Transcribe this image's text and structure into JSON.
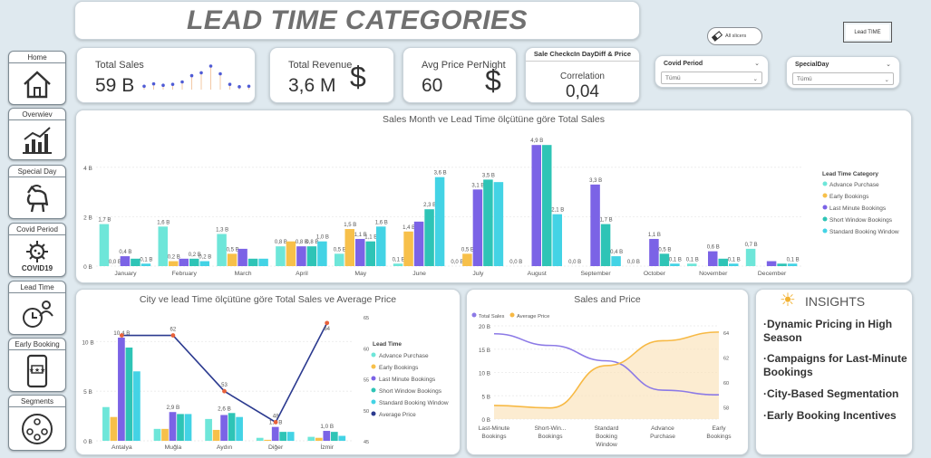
{
  "nav": [
    {
      "label": "Home",
      "icon": "house-icon"
    },
    {
      "label": "Overwiev",
      "icon": "bar-chart-icon"
    },
    {
      "label": "Special Day",
      "icon": "goat-icon"
    },
    {
      "label": "Covid Period",
      "icon": "covid-virus-icon",
      "caption": "COVID19"
    },
    {
      "label": "Lead Time",
      "icon": "lead-time-icon"
    },
    {
      "label": "Early Booking",
      "icon": "rating-phone-icon"
    },
    {
      "label": "Segments",
      "icon": "segments-people-icon"
    }
  ],
  "title": "LEAD TIME CATEGORIES",
  "buttons": {
    "all_slicers": "All slicers",
    "lead_time": "Lead TIME"
  },
  "kpis": {
    "total_sales": {
      "label": "Total Sales",
      "value": "59 B",
      "spark": [
        0.7,
        1.2,
        0.9,
        1.1,
        1.6,
        2.9,
        3.5,
        4.9,
        3.3,
        1.1,
        0.6,
        0.7
      ]
    },
    "total_revenue": {
      "label": "Total Revenue",
      "value": "3,6 M"
    },
    "avg_price": {
      "label": "Avg Price PerNight",
      "value": "60"
    },
    "correlation": {
      "header": "Sale CheckcIn DayDiff & Price",
      "label": "Correlation",
      "value": "0,04"
    }
  },
  "slicers": [
    {
      "label": "Covid Period",
      "value": "Tümü"
    },
    {
      "label": "SpecialDay",
      "value": "Tümü"
    }
  ],
  "insights": {
    "title": "INSIGHTS",
    "items": [
      "Dynamic Pricing in High Season",
      "Campaigns for Last-Minute Bookings",
      "City-Based Segmentation",
      "Early Booking Incentives"
    ]
  },
  "colors": {
    "advance": "#6ee6d9",
    "early": "#f7c04a",
    "last": "#7b63e6",
    "short": "#2ec4b6",
    "standard": "#43d3e5",
    "avgprice": "#2b3a8f",
    "avgpoint": "#e8623c",
    "salesline": "#8c7ae6",
    "priceline": "#f7b944"
  },
  "chart_data": [
    {
      "type": "bar",
      "title": "Sales Month ve Lead Time ölçütüne göre Total Sales",
      "categories": [
        "January",
        "February",
        "March",
        "April",
        "May",
        "June",
        "July",
        "August",
        "September",
        "October",
        "November",
        "December"
      ],
      "y_ticks": [
        "0 B",
        "2 B",
        "4 B"
      ],
      "ylim": [
        0,
        5.2
      ],
      "legend_title": "Lead Time Category",
      "legend_position": "right",
      "series": [
        {
          "name": "Advance Purchase",
          "values": [
            1.7,
            1.6,
            1.3,
            0.8,
            0.5,
            0.1,
            0.0,
            0.0,
            0.0,
            0.0,
            0.1,
            0.7
          ],
          "labels": [
            "1,7 B",
            "1,6 B",
            "1,3 B",
            "0,8 B",
            "0,5 B",
            "0,1 B",
            "0,0 B",
            "0,0 B",
            "0,0 B",
            "0,0 B",
            "0,1 B",
            "0,7 B"
          ]
        },
        {
          "name": "Early Bookings",
          "values": [
            0.0,
            0.2,
            0.5,
            1.0,
            1.5,
            1.4,
            0.5,
            0.0,
            0.0,
            0.0,
            0.0,
            0.0
          ],
          "labels": [
            "0,0 B",
            "0,2 B",
            "0,5 B",
            "",
            "1,5 B",
            "1,4 B",
            "0,5 B",
            "",
            "",
            "",
            "",
            ""
          ]
        },
        {
          "name": "Last Minute Bookings",
          "values": [
            0.4,
            0.3,
            0.7,
            0.8,
            1.1,
            1.8,
            3.1,
            4.9,
            3.3,
            1.1,
            0.6,
            0.2
          ],
          "labels": [
            "0,4 B",
            "",
            "",
            "0,8 B",
            "1,1 B",
            "",
            "3,1 B",
            "4,9 B",
            "3,3 B",
            "1,1 B",
            "0,6 B",
            ""
          ]
        },
        {
          "name": "Short Window Bookings",
          "values": [
            0.3,
            0.3,
            0.3,
            0.8,
            1.0,
            2.3,
            3.5,
            4.9,
            1.7,
            0.5,
            0.3,
            0.1
          ],
          "labels": [
            "",
            "0,2 B",
            "",
            "0,8 B",
            "1,1 B",
            "2,3 B",
            "3,5 B",
            "",
            "1,7 B",
            "0,5 B",
            "",
            ""
          ]
        },
        {
          "name": "Standard Booking Window",
          "values": [
            0.1,
            0.2,
            0.3,
            1.0,
            1.6,
            3.6,
            3.4,
            2.1,
            0.4,
            0.1,
            0.1,
            0.1
          ],
          "labels": [
            "0,1 B",
            "0,2 B",
            "",
            "1,0 B",
            "1,6 B",
            "3,6 B",
            "",
            "2,1 B",
            "0,4 B",
            "0,1 B",
            "0,1 B",
            "0,1 B"
          ]
        }
      ]
    },
    {
      "type": "bar",
      "title": "City ve lead Time ölçütüne göre Total Sales ve Average Price",
      "categories": [
        "Antalya",
        "Muğla",
        "Aydın",
        "Diğer",
        "İzmir"
      ],
      "y_ticks": [
        "0 B",
        "5 B",
        "10 B"
      ],
      "ylim": [
        0,
        12.5
      ],
      "y2_ticks": [
        "45",
        "50",
        "55",
        "60",
        "65"
      ],
      "y2lim": [
        45,
        65
      ],
      "legend_title": "Lead Time",
      "legend_position": "right",
      "series": [
        {
          "name": "Advance Purchase",
          "values": [
            3.4,
            1.2,
            2.2,
            0.3,
            0.4
          ]
        },
        {
          "name": "Early Bookings",
          "values": [
            2.4,
            1.2,
            1.1,
            0.1,
            0.3
          ]
        },
        {
          "name": "Last Minute Bookings",
          "values": [
            10.4,
            2.9,
            2.6,
            1.4,
            1.0
          ]
        },
        {
          "name": "Short Window Bookings",
          "values": [
            9.4,
            2.7,
            2.8,
            0.9,
            0.9
          ]
        },
        {
          "name": "Standard Booking Window",
          "values": [
            7.0,
            2.7,
            2.4,
            0.9,
            0.5
          ]
        }
      ],
      "bar_labels": [
        "10,4 B",
        "2,9 B",
        "2,6 B",
        "1,4 B",
        "1,0 B"
      ],
      "line": {
        "name": "Average  Price",
        "values": [
          62,
          62,
          53,
          48,
          64
        ],
        "labels": [
          "",
          "62",
          "53",
          "48",
          "64"
        ]
      }
    },
    {
      "type": "area",
      "title": "Sales and Price",
      "categories": [
        "Last-Minute Bookings",
        "Short-Win... Bookings",
        "Standard Booking Window",
        "Advance Purchase",
        "Early Bookings"
      ],
      "y_ticks": [
        "0 B",
        "5 B",
        "10 B",
        "15 B",
        "20 B"
      ],
      "ylim": [
        0,
        20
      ],
      "y2_ticks": [
        "58",
        "60",
        "62",
        "64"
      ],
      "y2lim": [
        57,
        64.5
      ],
      "legend_position": "top-left",
      "series": [
        {
          "name": "Total Sales",
          "values": [
            18.3,
            15.8,
            12.5,
            6.2,
            5.2
          ]
        },
        {
          "name": "Average Price",
          "values": [
            58.1,
            57.9,
            61.3,
            63.3,
            64.0
          ]
        }
      ]
    }
  ]
}
